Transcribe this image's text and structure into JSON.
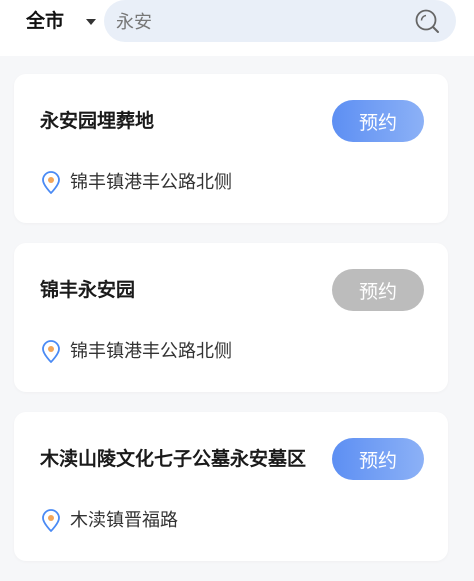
{
  "header": {
    "city_label": "全市",
    "search": {
      "value": "永安",
      "icon": "search-icon"
    }
  },
  "results": [
    {
      "name": "永安园埋葬地",
      "address": "锦丰镇港丰公路北侧",
      "button_label": "预约",
      "button_state": "active"
    },
    {
      "name": "锦丰永安园",
      "address": "锦丰镇港丰公路北侧",
      "button_label": "预约",
      "button_state": "disabled"
    },
    {
      "name": "木渎山陵文化七子公墓永安墓区",
      "address": "木渎镇晋福路",
      "button_label": "预约",
      "button_state": "active"
    }
  ],
  "colors": {
    "button_active_start": "#5d8ff3",
    "button_active_end": "#8cb1f6",
    "button_disabled": "#bcbcbc",
    "pin_outline": "#4a8af4",
    "pin_dot": "#f2a65a",
    "search_bg": "#e9eff8"
  }
}
